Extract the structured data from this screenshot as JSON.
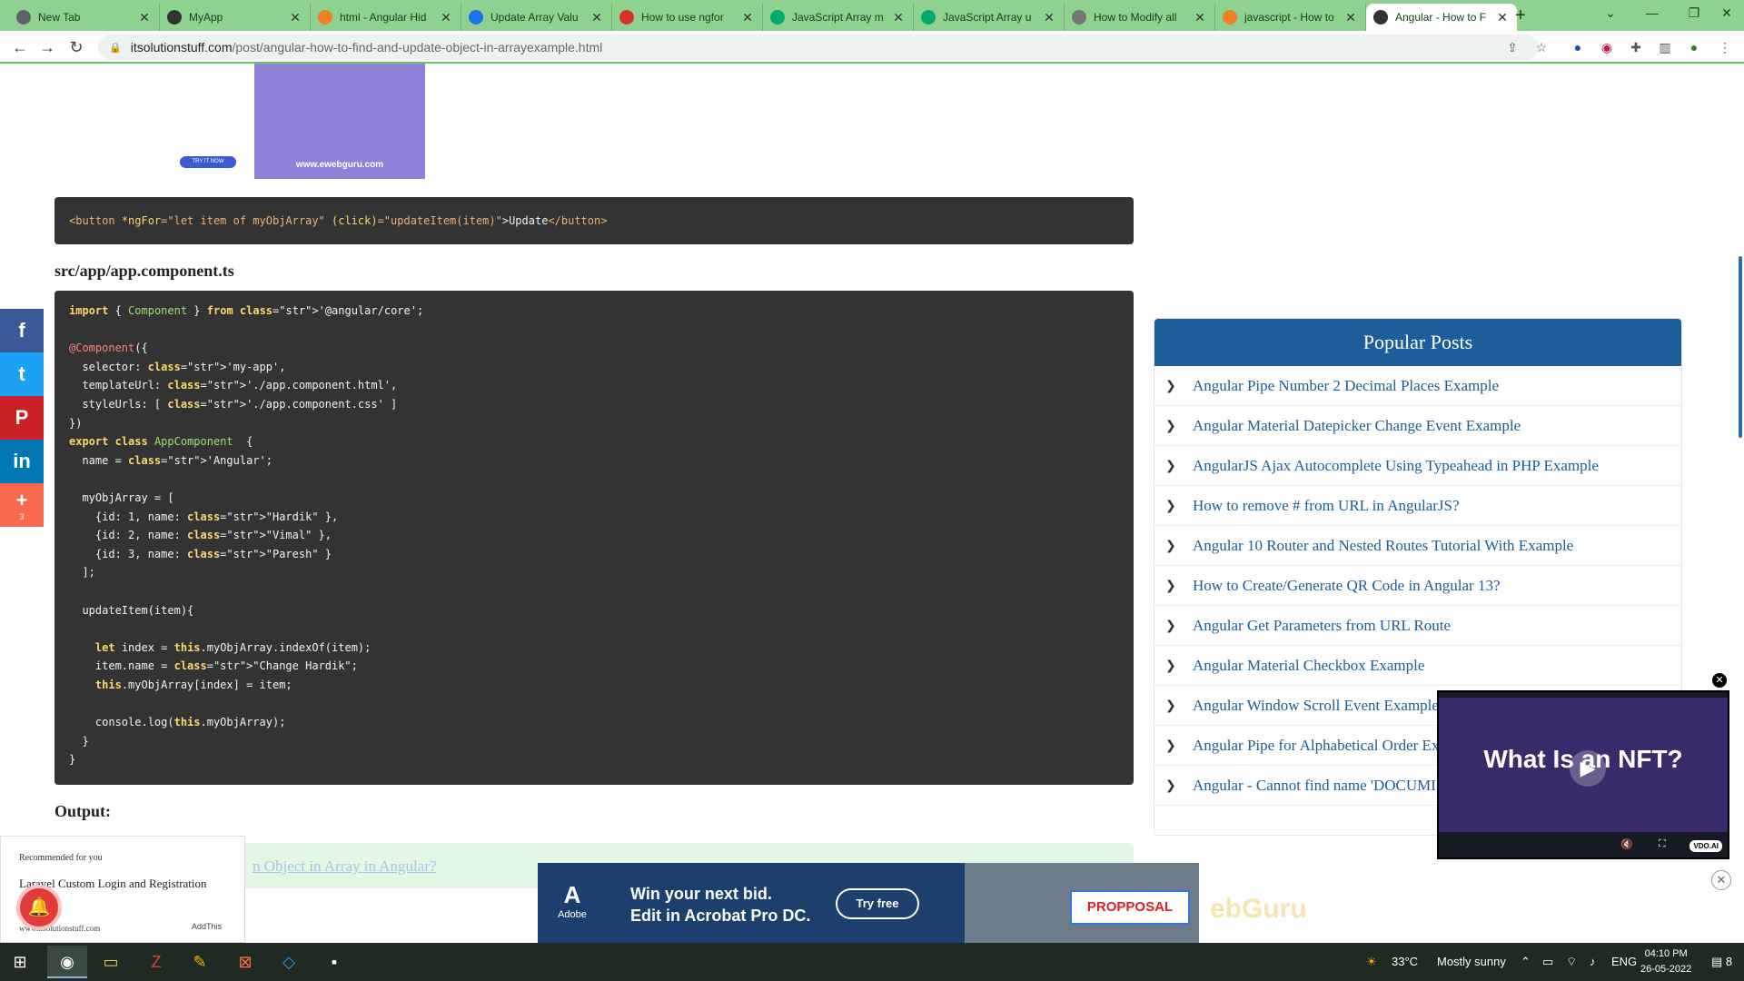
{
  "browser": {
    "tabs": [
      {
        "title": "New Tab",
        "icon": "chrome-icon",
        "color": "#5f6368"
      },
      {
        "title": "MyApp",
        "icon": "angular-icon",
        "color": "#333333"
      },
      {
        "title": "html - Angular Hid",
        "icon": "stackoverflow-icon",
        "color": "#f48024"
      },
      {
        "title": "Update Array Valu",
        "icon": "globe-icon",
        "color": "#1a73e8"
      },
      {
        "title": "How to use ngfor",
        "icon": "bookmark-icon",
        "color": "#d93025"
      },
      {
        "title": "JavaScript Array m",
        "icon": "w3schools-icon",
        "color": "#04aa6d"
      },
      {
        "title": "JavaScript Array u",
        "icon": "w3schools-icon",
        "color": "#04aa6d"
      },
      {
        "title": "How to Modify all",
        "icon": "site-icon",
        "color": "#777777"
      },
      {
        "title": "javascript - How to",
        "icon": "stackoverflow-icon",
        "color": "#f48024"
      },
      {
        "title": "Angular - How to F",
        "icon": "site-icon",
        "color": "#333333"
      }
    ],
    "url_host": "itsolutionstuff.com",
    "url_path": "/post/angular-how-to-find-and-update-object-in-arrayexample.html",
    "accent": "#8fd28f"
  },
  "ad_top": {
    "url_text": "www.ewebguru.com",
    "button": "TRY IT NOW"
  },
  "code1": {
    "parts": [
      "<button ",
      "*ngFor",
      "=\"let item of myObjArray\" ",
      "(click)",
      "=\"updateItem(item)\"",
      ">Update",
      "</button>"
    ]
  },
  "filename": "src/app/app.component.ts",
  "code2_lines": [
    "import { Component } from '@angular/core';",
    "",
    "@Component({",
    "  selector: 'my-app',",
    "  templateUrl: './app.component.html',",
    "  styleUrls: [ './app.component.css' ]",
    "})",
    "export class AppComponent  {",
    "  name = 'Angular';",
    "",
    "  myObjArray = [",
    "    {id: 1, name: \"Hardik\" },",
    "    {id: 2, name: \"Vimal\" },",
    "    {id: 3, name: \"Paresh\" }",
    "  ];",
    "",
    "  updateItem(item){",
    "",
    "    let index = this.myObjArray.indexOf(item);",
    "    item.name = \"Change Hardik\";",
    "    this.myObjArray[index] = item;",
    "",
    "    console.log(this.myObjArray);",
    "  }",
    "}"
  ],
  "output_label": "Output:",
  "output_link": "n Object in Array in Angular?",
  "social": [
    {
      "name": "facebook",
      "glyph": "f",
      "color": "#3b5998",
      "count": ""
    },
    {
      "name": "twitter",
      "glyph": "t",
      "color": "#1da1f2",
      "count": ""
    },
    {
      "name": "pinterest",
      "glyph": "P",
      "color": "#cb2027",
      "count": ""
    },
    {
      "name": "linkedin",
      "glyph": "in",
      "color": "#0077b5",
      "count": ""
    },
    {
      "name": "addthis",
      "glyph": "+",
      "color": "#f8694d",
      "count": "3"
    }
  ],
  "popular": {
    "title": "Popular Posts",
    "items": [
      "Angular Pipe Number 2 Decimal Places Example",
      "Angular Material Datepicker Change Event Example",
      "AngularJS Ajax Autocomplete Using Typeahead in PHP Example",
      "How to remove # from URL in AngularJS?",
      "Angular 10 Router and Nested Routes Tutorial With Example",
      "How to Create/Generate QR Code in Angular 13?",
      "Angular Get Parameters from URL Route",
      "Angular Material Checkbox Example",
      "Angular Window Scroll Event Example",
      "Angular Pipe for Alphabetical Order Ex",
      "Angular - Cannot find name 'DOCUMI"
    ]
  },
  "video": {
    "title": "What Is an NFT?",
    "badge": "VDO.AI"
  },
  "recommend": {
    "heading": "Recommended for you",
    "title": "Laravel Custom Login and Registration",
    "site": "www.itsolutionstuff.com",
    "brand": "AddThis"
  },
  "bottom_ad": {
    "brand": "Adobe",
    "line1": "Win your next bid.",
    "line2": "Edit in Acrobat Pro DC.",
    "cta": "Try free",
    "stamp": "PROPPOSAL"
  },
  "taskbar": {
    "weather_temp": "33°C",
    "weather_text": "Mostly sunny",
    "lang": "ENG",
    "time": "04:10 PM",
    "date": "26-05-2022",
    "notif_count": "8"
  }
}
